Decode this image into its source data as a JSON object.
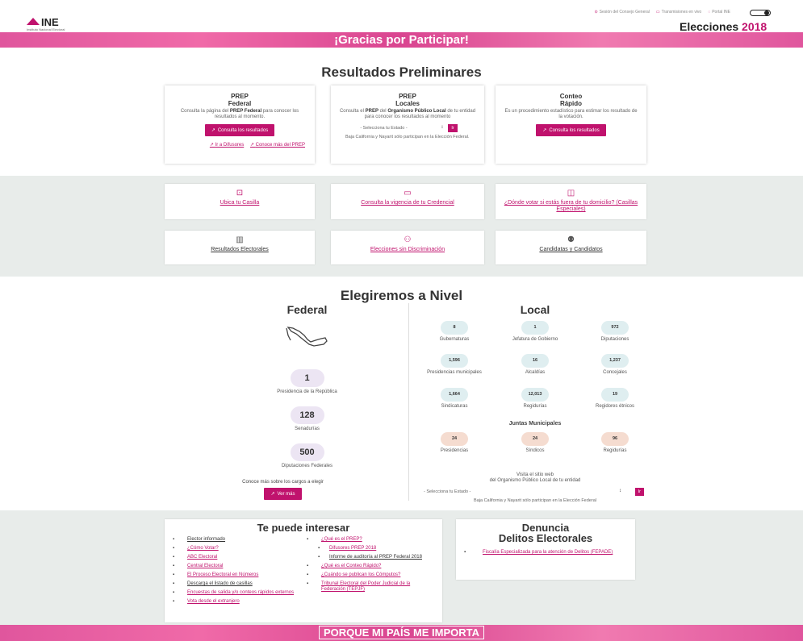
{
  "header": {
    "logo_text": "INE",
    "logo_subtitle": "Instituto Nacional Electoral",
    "top_links": [
      "Sesión del Consejo General",
      "Transmisiones en vivo",
      "Portal INE"
    ],
    "elecciones_label": "Elecciones",
    "elecciones_year": "2018"
  },
  "banner_top": "¡Gracias por Participar!",
  "resultados": {
    "title": "Resultados Preliminares",
    "federal": {
      "title_line1": "PREP",
      "title_line2": "Federal",
      "desc_a": "Consulta la página del ",
      "desc_b": "PREP Federal",
      "desc_c": " para conocer los resultados al momento.",
      "button": "Consulta los resultados",
      "link1": "Ir a Difusores",
      "link2": "Conoce más del PREP"
    },
    "locales": {
      "title_line1": "PREP",
      "title_line2": "Locales",
      "desc_a": "Consulta el ",
      "desc_b": "PREP",
      "desc_c": " del ",
      "desc_d": "Organismo Público Local",
      "desc_e": " de tu entidad para conocer los resultados al momento",
      "select": "- Selecciona tu Estado -",
      "ir": "Ir",
      "note": "Baja California y Nayarit sólo participan en la Elección Federal."
    },
    "conteo": {
      "title_line1": "Conteo",
      "title_line2": "Rápido",
      "desc": "Es un procedimiento estadístico para estimar los resultado de la votación.",
      "button": "Consulta los resultados"
    }
  },
  "tiles": [
    {
      "label": "Ubica tu Casilla",
      "icon": "ballot-box-icon"
    },
    {
      "label": "Consulta la vigencia de tu Credencial",
      "icon": "id-card-icon"
    },
    {
      "label": "¿Dónde votar si estás fuera de tu domicilio? (Casillas Especiales)",
      "icon": "special-booth-icon"
    },
    {
      "label": "Resultados Electorales",
      "icon": "bar-chart-icon"
    },
    {
      "label": "Elecciones sin Discriminación",
      "icon": "people-icon"
    },
    {
      "label": "Candidatas y Candidatos",
      "icon": "candidates-icon"
    }
  ],
  "elegiremos": {
    "title": "Elegiremos a Nivel",
    "federal_title": "Federal",
    "federal_items": [
      {
        "value": "1",
        "label": "Presidencia de la República"
      },
      {
        "value": "128",
        "label": "Senadurías"
      },
      {
        "value": "500",
        "label": "Diputaciones Federales"
      }
    ],
    "conoce_text": "Conoce más sobre los cargos a elegir",
    "ver_mas": "Ver más",
    "local_title": "Local",
    "local_items": [
      {
        "value": "8",
        "label": "Gubernaturas"
      },
      {
        "value": "1",
        "label": "Jefatura de Gobierno"
      },
      {
        "value": "972",
        "label": "Diputaciones"
      },
      {
        "value": "1,596",
        "label": "Presidencias municipales"
      },
      {
        "value": "16",
        "label": "Alcaldías"
      },
      {
        "value": "1,237",
        "label": "Concejales"
      },
      {
        "value": "1,664",
        "label": "Sindicaturas"
      },
      {
        "value": "12,013",
        "label": "Regidurías"
      },
      {
        "value": "19",
        "label": "Regidores étnicos"
      }
    ],
    "juntas_title": "Juntas Municipales",
    "juntas_items": [
      {
        "value": "24",
        "label": "Presidencias"
      },
      {
        "value": "24",
        "label": "Síndicos"
      },
      {
        "value": "96",
        "label": "Regidurías"
      }
    ],
    "visita_line1": "Visita el sitio web",
    "visita_line2": "del Organismo Público Local de tu entidad",
    "local_select": "- Selecciona tu Estado -",
    "local_ir": "Ir",
    "local_note": "Baja California y Nayarit sólo participan en la Elección Federal"
  },
  "interesar": {
    "title": "Te puede interesar",
    "left": [
      {
        "text": "Elector informado",
        "dark": true
      },
      {
        "text": "¿Cómo Votar?"
      },
      {
        "text": "ABC Electoral"
      },
      {
        "text": "Central Electoral"
      },
      {
        "text": "El Proceso Electoral en Números"
      },
      {
        "text": "Descarga el listado de casillas",
        "dark": true
      },
      {
        "text": "Encuestas de salida y/o conteos rápidos externos"
      },
      {
        "text": "Vota desde el extranjero"
      }
    ],
    "right": [
      {
        "text": "¿Qué es el PREP?"
      },
      {
        "text": "Difusores PREP 2018",
        "sub": true
      },
      {
        "text": "Informe de auditoría al PREP Federal 2018",
        "sub": true,
        "dark": true
      },
      {
        "text": "¿Qué es el Conteo Rápido?"
      },
      {
        "text": "¿Cuándo se publican los Cómputos?"
      },
      {
        "text": "Tribunal Electoral del Poder Judicial de la Federación (TEPJF)"
      }
    ]
  },
  "denuncia": {
    "title_line1": "Denuncia",
    "title_line2": "Delitos Electorales",
    "link": "Fiscalía Especializada para la atención de Delitos (FEPADE)"
  },
  "banner_bottom": "PORQUE MI PAÍS ME IMPORTA",
  "colors": {
    "accent": "#c0126d",
    "banner": "#e0569d",
    "gray_band": "#e8ecea"
  }
}
